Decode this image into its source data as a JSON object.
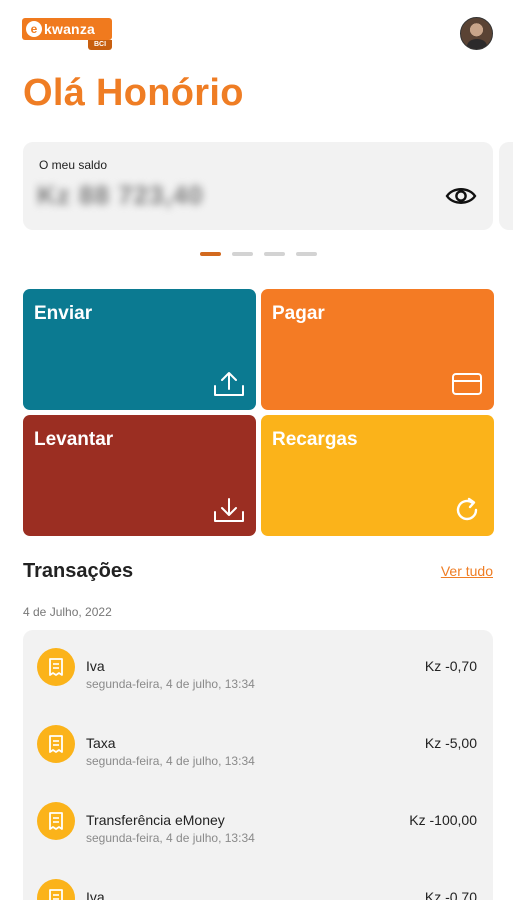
{
  "header": {
    "logo_text": "kwanza",
    "logo_letter": "e",
    "logo_sub": "BCI"
  },
  "greeting": "Olá Honório",
  "balance": {
    "label": "O meu saldo",
    "value": "Kz 88 723,40"
  },
  "pager": {
    "count": 4,
    "active": 0
  },
  "actions": [
    {
      "label": "Enviar",
      "icon": "upload-icon",
      "color": "#0b7a91"
    },
    {
      "label": "Pagar",
      "icon": "card-icon",
      "color": "#f47b24"
    },
    {
      "label": "Levantar",
      "icon": "download-icon",
      "color": "#9b2e22"
    },
    {
      "label": "Recargas",
      "icon": "refresh-icon",
      "color": "#fbb31a"
    }
  ],
  "transactions": {
    "title": "Transações",
    "see_all": "Ver tudo",
    "date_group": "4 de Julho, 2022",
    "items": [
      {
        "name": "Iva",
        "date": "segunda-feira, 4 de julho, 13:34",
        "amount": "Kz -0,70"
      },
      {
        "name": "Taxa",
        "date": "segunda-feira, 4 de julho, 13:34",
        "amount": "Kz -5,00"
      },
      {
        "name": "Transferência eMoney",
        "date": "segunda-feira, 4 de julho, 13:34",
        "amount": "Kz -100,00"
      },
      {
        "name": "Iva",
        "date": "",
        "amount": "Kz -0,70"
      }
    ]
  },
  "colors": {
    "accent": "#ef7d24",
    "tx_icon": "#fbb31a"
  }
}
